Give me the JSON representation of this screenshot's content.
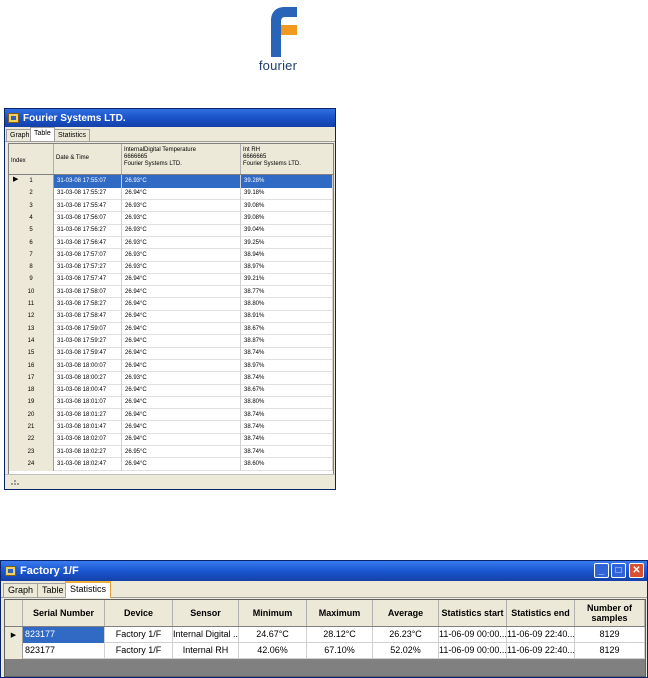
{
  "logo": {
    "text": "fourier",
    "colors": {
      "blue": "#2a64b8",
      "orange": "#f29a1f"
    }
  },
  "window1": {
    "title": "Fourier Systems LTD.",
    "tabs": [
      "Graph",
      "Table",
      "Statistics"
    ],
    "active_tab": "Table",
    "columns": {
      "index": "Index",
      "datetime": "Date & Time",
      "temp": [
        "InternalDigital Temperature",
        "6666665",
        "Fourier Systems LTD."
      ],
      "rh": [
        "Int RH",
        "6666665",
        "Fourier Systems LTD."
      ]
    },
    "rows": [
      {
        "i": "1",
        "t": "31-03-08 17:55:07",
        "temp": "26.93°C",
        "rh": "39.28%"
      },
      {
        "i": "2",
        "t": "31-03-08 17:55:27",
        "temp": "26.94°C",
        "rh": "39.18%"
      },
      {
        "i": "3",
        "t": "31-03-08 17:55:47",
        "temp": "26.93°C",
        "rh": "39.08%"
      },
      {
        "i": "4",
        "t": "31-03-08 17:56:07",
        "temp": "26.93°C",
        "rh": "39.08%"
      },
      {
        "i": "5",
        "t": "31-03-08 17:56:27",
        "temp": "26.93°C",
        "rh": "39.04%"
      },
      {
        "i": "6",
        "t": "31-03-08 17:56:47",
        "temp": "26.93°C",
        "rh": "39.25%"
      },
      {
        "i": "7",
        "t": "31-03-08 17:57:07",
        "temp": "26.93°C",
        "rh": "38.94%"
      },
      {
        "i": "8",
        "t": "31-03-08 17:57:27",
        "temp": "26.93°C",
        "rh": "38.97%"
      },
      {
        "i": "9",
        "t": "31-03-08 17:57:47",
        "temp": "26.94°C",
        "rh": "39.21%"
      },
      {
        "i": "10",
        "t": "31-03-08 17:58:07",
        "temp": "26.94°C",
        "rh": "38.77%"
      },
      {
        "i": "11",
        "t": "31-03-08 17:58:27",
        "temp": "26.94°C",
        "rh": "38.80%"
      },
      {
        "i": "12",
        "t": "31-03-08 17:58:47",
        "temp": "26.94°C",
        "rh": "38.91%"
      },
      {
        "i": "13",
        "t": "31-03-08 17:59:07",
        "temp": "26.94°C",
        "rh": "38.67%"
      },
      {
        "i": "14",
        "t": "31-03-08 17:59:27",
        "temp": "26.94°C",
        "rh": "38.87%"
      },
      {
        "i": "15",
        "t": "31-03-08 17:59:47",
        "temp": "26.94°C",
        "rh": "38.74%"
      },
      {
        "i": "16",
        "t": "31-03-08 18:00:07",
        "temp": "26.94°C",
        "rh": "38.97%"
      },
      {
        "i": "17",
        "t": "31-03-08 18:00:27",
        "temp": "26.93°C",
        "rh": "38.74%"
      },
      {
        "i": "18",
        "t": "31-03-08 18:00:47",
        "temp": "26.94°C",
        "rh": "38.67%"
      },
      {
        "i": "19",
        "t": "31-03-08 18:01:07",
        "temp": "26.94°C",
        "rh": "38.80%"
      },
      {
        "i": "20",
        "t": "31-03-08 18:01:27",
        "temp": "26.94°C",
        "rh": "38.74%"
      },
      {
        "i": "21",
        "t": "31-03-08 18:01:47",
        "temp": "26.94°C",
        "rh": "38.74%"
      },
      {
        "i": "22",
        "t": "31-03-08 18:02:07",
        "temp": "26.94°C",
        "rh": "38.74%"
      },
      {
        "i": "23",
        "t": "31-03-08 18:02:27",
        "temp": "26.95°C",
        "rh": "38.74%"
      },
      {
        "i": "24",
        "t": "31-03-08 18:02:47",
        "temp": "26.94°C",
        "rh": "38.60%"
      }
    ]
  },
  "window2": {
    "title": "Factory 1/F",
    "tabs": [
      "Graph",
      "Table",
      "Statistics"
    ],
    "active_tab": "Statistics",
    "columns": [
      "Serial Number",
      "Device",
      "Sensor",
      "Minimum",
      "Maximum",
      "Average",
      "Statistics start",
      "Statistics end",
      "Number of samples"
    ],
    "rows": [
      [
        "823177",
        "Factory 1/F",
        "Internal Digital ...",
        "24.67°C",
        "28.12°C",
        "26.23°C",
        "11-06-09 00:00...",
        "11-06-09 22:40...",
        "8129"
      ],
      [
        "823177",
        "Factory 1/F",
        "Internal RH",
        "42.06%",
        "67.10%",
        "52.02%",
        "11-06-09 00:00...",
        "11-06-09 22:40...",
        "8129"
      ]
    ]
  }
}
